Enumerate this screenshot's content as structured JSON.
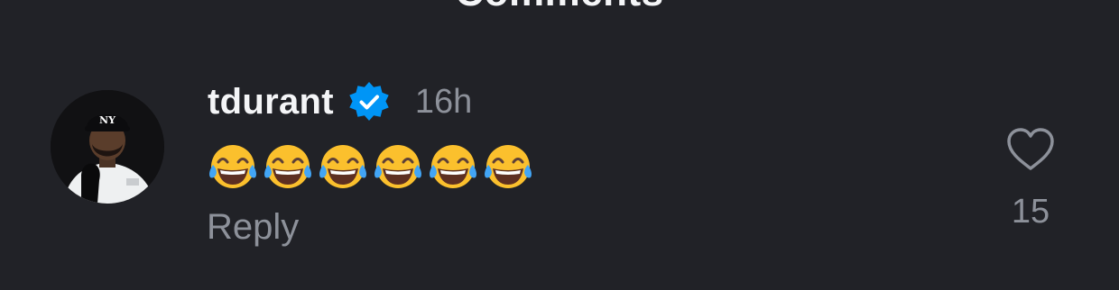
{
  "header": {
    "title": "Comments"
  },
  "comment": {
    "username": "tdurant",
    "verified_icon": "verified-badge-icon",
    "time": "16h",
    "emoji_icon": "face-with-tears-of-joy-icon",
    "emoji_count": 6,
    "reply_label": "Reply",
    "like_icon": "heart-outline-icon",
    "like_count": "15"
  },
  "colors": {
    "background": "#212227",
    "primary_text": "#f4f5f7",
    "secondary_text": "#8d919a",
    "verified_blue": "#0095f6"
  }
}
